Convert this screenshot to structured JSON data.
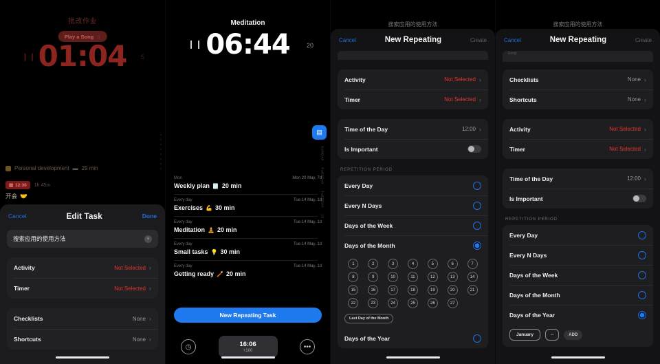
{
  "panel1": {
    "focus": {
      "title": "批改作业",
      "song_label": "Play a Song",
      "song_icon": "music-note-icon",
      "clock": "01:04",
      "pause_icon": "❙❙",
      "skip_label": "5",
      "chip_label": "Personal development",
      "chip_icon": "book-icon",
      "chip_duration": "29 min",
      "badge_time": "12:30",
      "badge_icon": "calendar-icon",
      "badge_duration": "1h 45m",
      "meeting_label": "开会",
      "meeting_emoji": "🤝"
    },
    "sheet": {
      "cancel": "Cancel",
      "title": "Edit Task",
      "done": "Done",
      "task_name": "搜索应用的使用方法",
      "clear_icon": "×",
      "rows_group1": [
        {
          "label": "Activity",
          "value": "Not Selected",
          "state": "red"
        },
        {
          "label": "Timer",
          "value": "Not Selected",
          "state": "red"
        }
      ],
      "rows_group2": [
        {
          "label": "Checklists",
          "value": "None",
          "state": "grey"
        },
        {
          "label": "Shortcuts",
          "value": "None",
          "state": "grey"
        }
      ]
    }
  },
  "panel2": {
    "timer": {
      "title": "Meditation",
      "clock": "06:44",
      "pause_icon": "❙❙",
      "badge": "20"
    },
    "fab_icon": "stack-icon",
    "side_labels": [
      "SUNDAY",
      "TUESDAY",
      "TUESDAY",
      "13"
    ],
    "tasks": [
      {
        "repeat": "Mon",
        "when": "Mon 20 May, 7d",
        "name": "Weekly plan",
        "emoji": "🗒️",
        "duration": "20 min"
      },
      {
        "repeat": "Every day",
        "when": "Tue 14 May, 1d",
        "name": "Exercises",
        "emoji": "💪",
        "duration": "30 min"
      },
      {
        "repeat": "Every day",
        "when": "Tue 14 May, 1d",
        "name": "Meditation",
        "emoji": "🧘",
        "duration": "20 min"
      },
      {
        "repeat": "Every day",
        "when": "Tue 14 May, 1d",
        "name": "Small tasks",
        "emoji": "💡",
        "duration": "30 min"
      },
      {
        "repeat": "Every day",
        "when": "Tue 14 May, 1d",
        "name": "Getting ready",
        "emoji": "🪥",
        "duration": "20 min"
      }
    ],
    "cta": "New Repeating Task",
    "tabbar": {
      "left_icon": "timer-icon",
      "right_icon": "ellipsis-icon",
      "center_time": "16:06",
      "center_sub": "+100"
    }
  },
  "panel3": {
    "bg_title": "搜索应用的使用方法",
    "cancel": "Cancel",
    "title": "New Repeating",
    "create": "Create",
    "rows_top": [
      {
        "label": "Activity",
        "value": "Not Selected",
        "state": "red"
      },
      {
        "label": "Timer",
        "value": "Not Selected",
        "state": "red"
      }
    ],
    "rows_mid": [
      {
        "label": "Time of the Day",
        "value": "12:00",
        "state": "grey"
      },
      {
        "label": "Is Important",
        "value": "",
        "state": "toggle"
      }
    ],
    "section_header": "REPETITION PERIOD",
    "options": [
      {
        "label": "Every Day",
        "selected": false
      },
      {
        "label": "Every N Days",
        "selected": false
      },
      {
        "label": "Days of the Week",
        "selected": false
      },
      {
        "label": "Days of the Month",
        "selected": true
      },
      {
        "label": "Days of the Year",
        "selected": false
      }
    ],
    "month_days": [
      "1",
      "2",
      "3",
      "4",
      "5",
      "6",
      "7",
      "8",
      "9",
      "10",
      "11",
      "12",
      "13",
      "14",
      "15",
      "16",
      "17",
      "18",
      "19",
      "20",
      "21",
      "22",
      "23",
      "24",
      "25",
      "26",
      "27"
    ],
    "last_day_label": "Last Day of the Month"
  },
  "panel4": {
    "bg_title": "搜索应用的使用方法",
    "cancel": "Cancel",
    "title": "New Repeating",
    "create": "Create",
    "stub_label": "Emoji",
    "rows_top": [
      {
        "label": "Checklists",
        "value": "None",
        "state": "grey"
      },
      {
        "label": "Shortcuts",
        "value": "None",
        "state": "grey"
      }
    ],
    "rows_mid": [
      {
        "label": "Activity",
        "value": "Not Selected",
        "state": "red"
      },
      {
        "label": "Timer",
        "value": "Not Selected",
        "state": "red"
      }
    ],
    "rows_time": [
      {
        "label": "Time of the Day",
        "value": "12:00",
        "state": "grey"
      },
      {
        "label": "Is Important",
        "value": "",
        "state": "toggle"
      }
    ],
    "section_header": "REPETITION PERIOD",
    "options": [
      {
        "label": "Every Day",
        "selected": false
      },
      {
        "label": "Every N Days",
        "selected": false
      },
      {
        "label": "Days of the Week",
        "selected": false
      },
      {
        "label": "Days of the Month",
        "selected": false
      },
      {
        "label": "Days of the Year",
        "selected": true
      }
    ],
    "year_month": "January",
    "year_day": "--",
    "year_add": "ADD"
  },
  "colors": {
    "accent_blue": "#1f7af0",
    "danger_red": "#e0352f",
    "sheet_bg": "#1b1b1d",
    "focus_red": "#8e2420"
  }
}
